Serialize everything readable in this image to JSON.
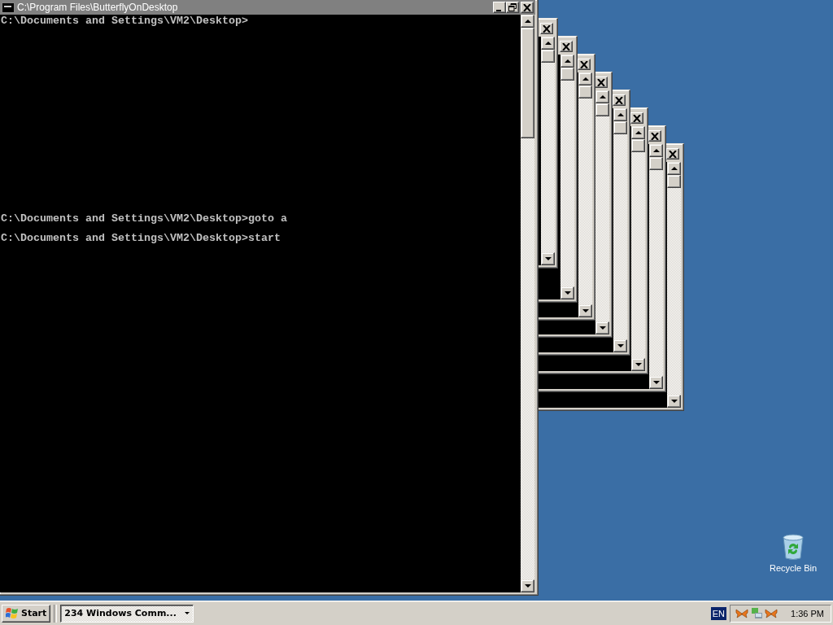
{
  "main_window": {
    "title": "C:\\Program Files\\ButterflyOnDesktop",
    "console_lines": [
      "C:\\Documents and Settings\\VM2\\Desktop>",
      "C:\\Documents and Settings\\VM2\\Desktop>goto a",
      "C:\\Documents and Settings\\VM2\\Desktop>start"
    ]
  },
  "desktop_icons": [
    {
      "label": "Recycle Bin"
    }
  ],
  "taskbar": {
    "start_label": "Start",
    "tasks": [
      {
        "label": "234 Windows Comm...",
        "selected": true
      }
    ],
    "language": "EN",
    "clock": "1:36 PM"
  }
}
